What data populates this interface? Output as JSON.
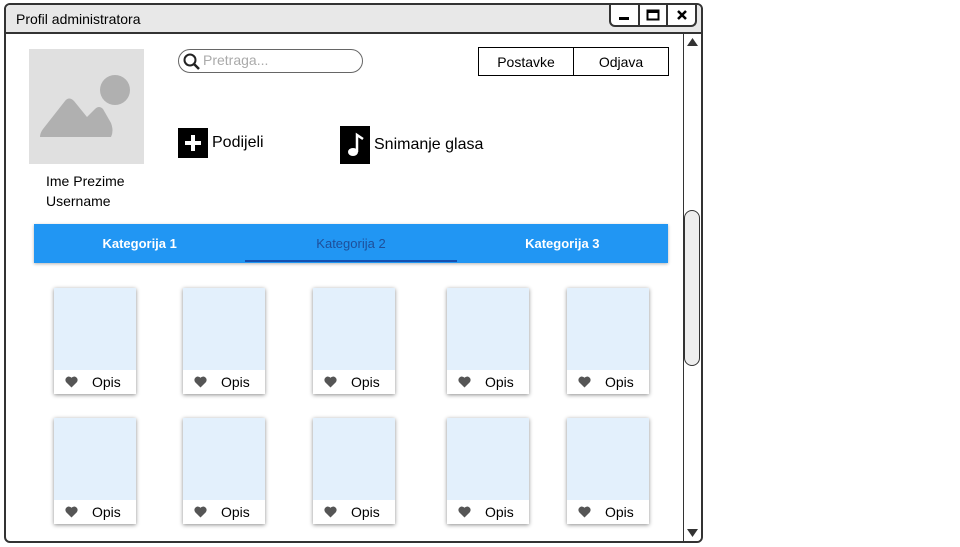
{
  "window": {
    "title": "Profil administratora"
  },
  "profile": {
    "full_name": "Ime Prezime",
    "username": "Username"
  },
  "search": {
    "placeholder": "Pretraga..."
  },
  "header_buttons": {
    "settings": "Postavke",
    "logout": "Odjava"
  },
  "actions": {
    "share": "Podijeli",
    "voice": "Snimanje glasa"
  },
  "tabs": [
    {
      "label": "Kategorija 1"
    },
    {
      "label": "Kategorija 2",
      "active": true
    },
    {
      "label": "Kategorija 3"
    }
  ],
  "cards": [
    {
      "label": "Opis"
    },
    {
      "label": "Opis"
    },
    {
      "label": "Opis"
    },
    {
      "label": "Opis"
    },
    {
      "label": "Opis"
    },
    {
      "label": "Opis"
    },
    {
      "label": "Opis"
    },
    {
      "label": "Opis"
    },
    {
      "label": "Opis"
    },
    {
      "label": "Opis"
    }
  ],
  "colors": {
    "tab_bar": "#2196f3",
    "card_thumb": "#e3f0fc",
    "avatar_bg": "#e0e0e0"
  }
}
